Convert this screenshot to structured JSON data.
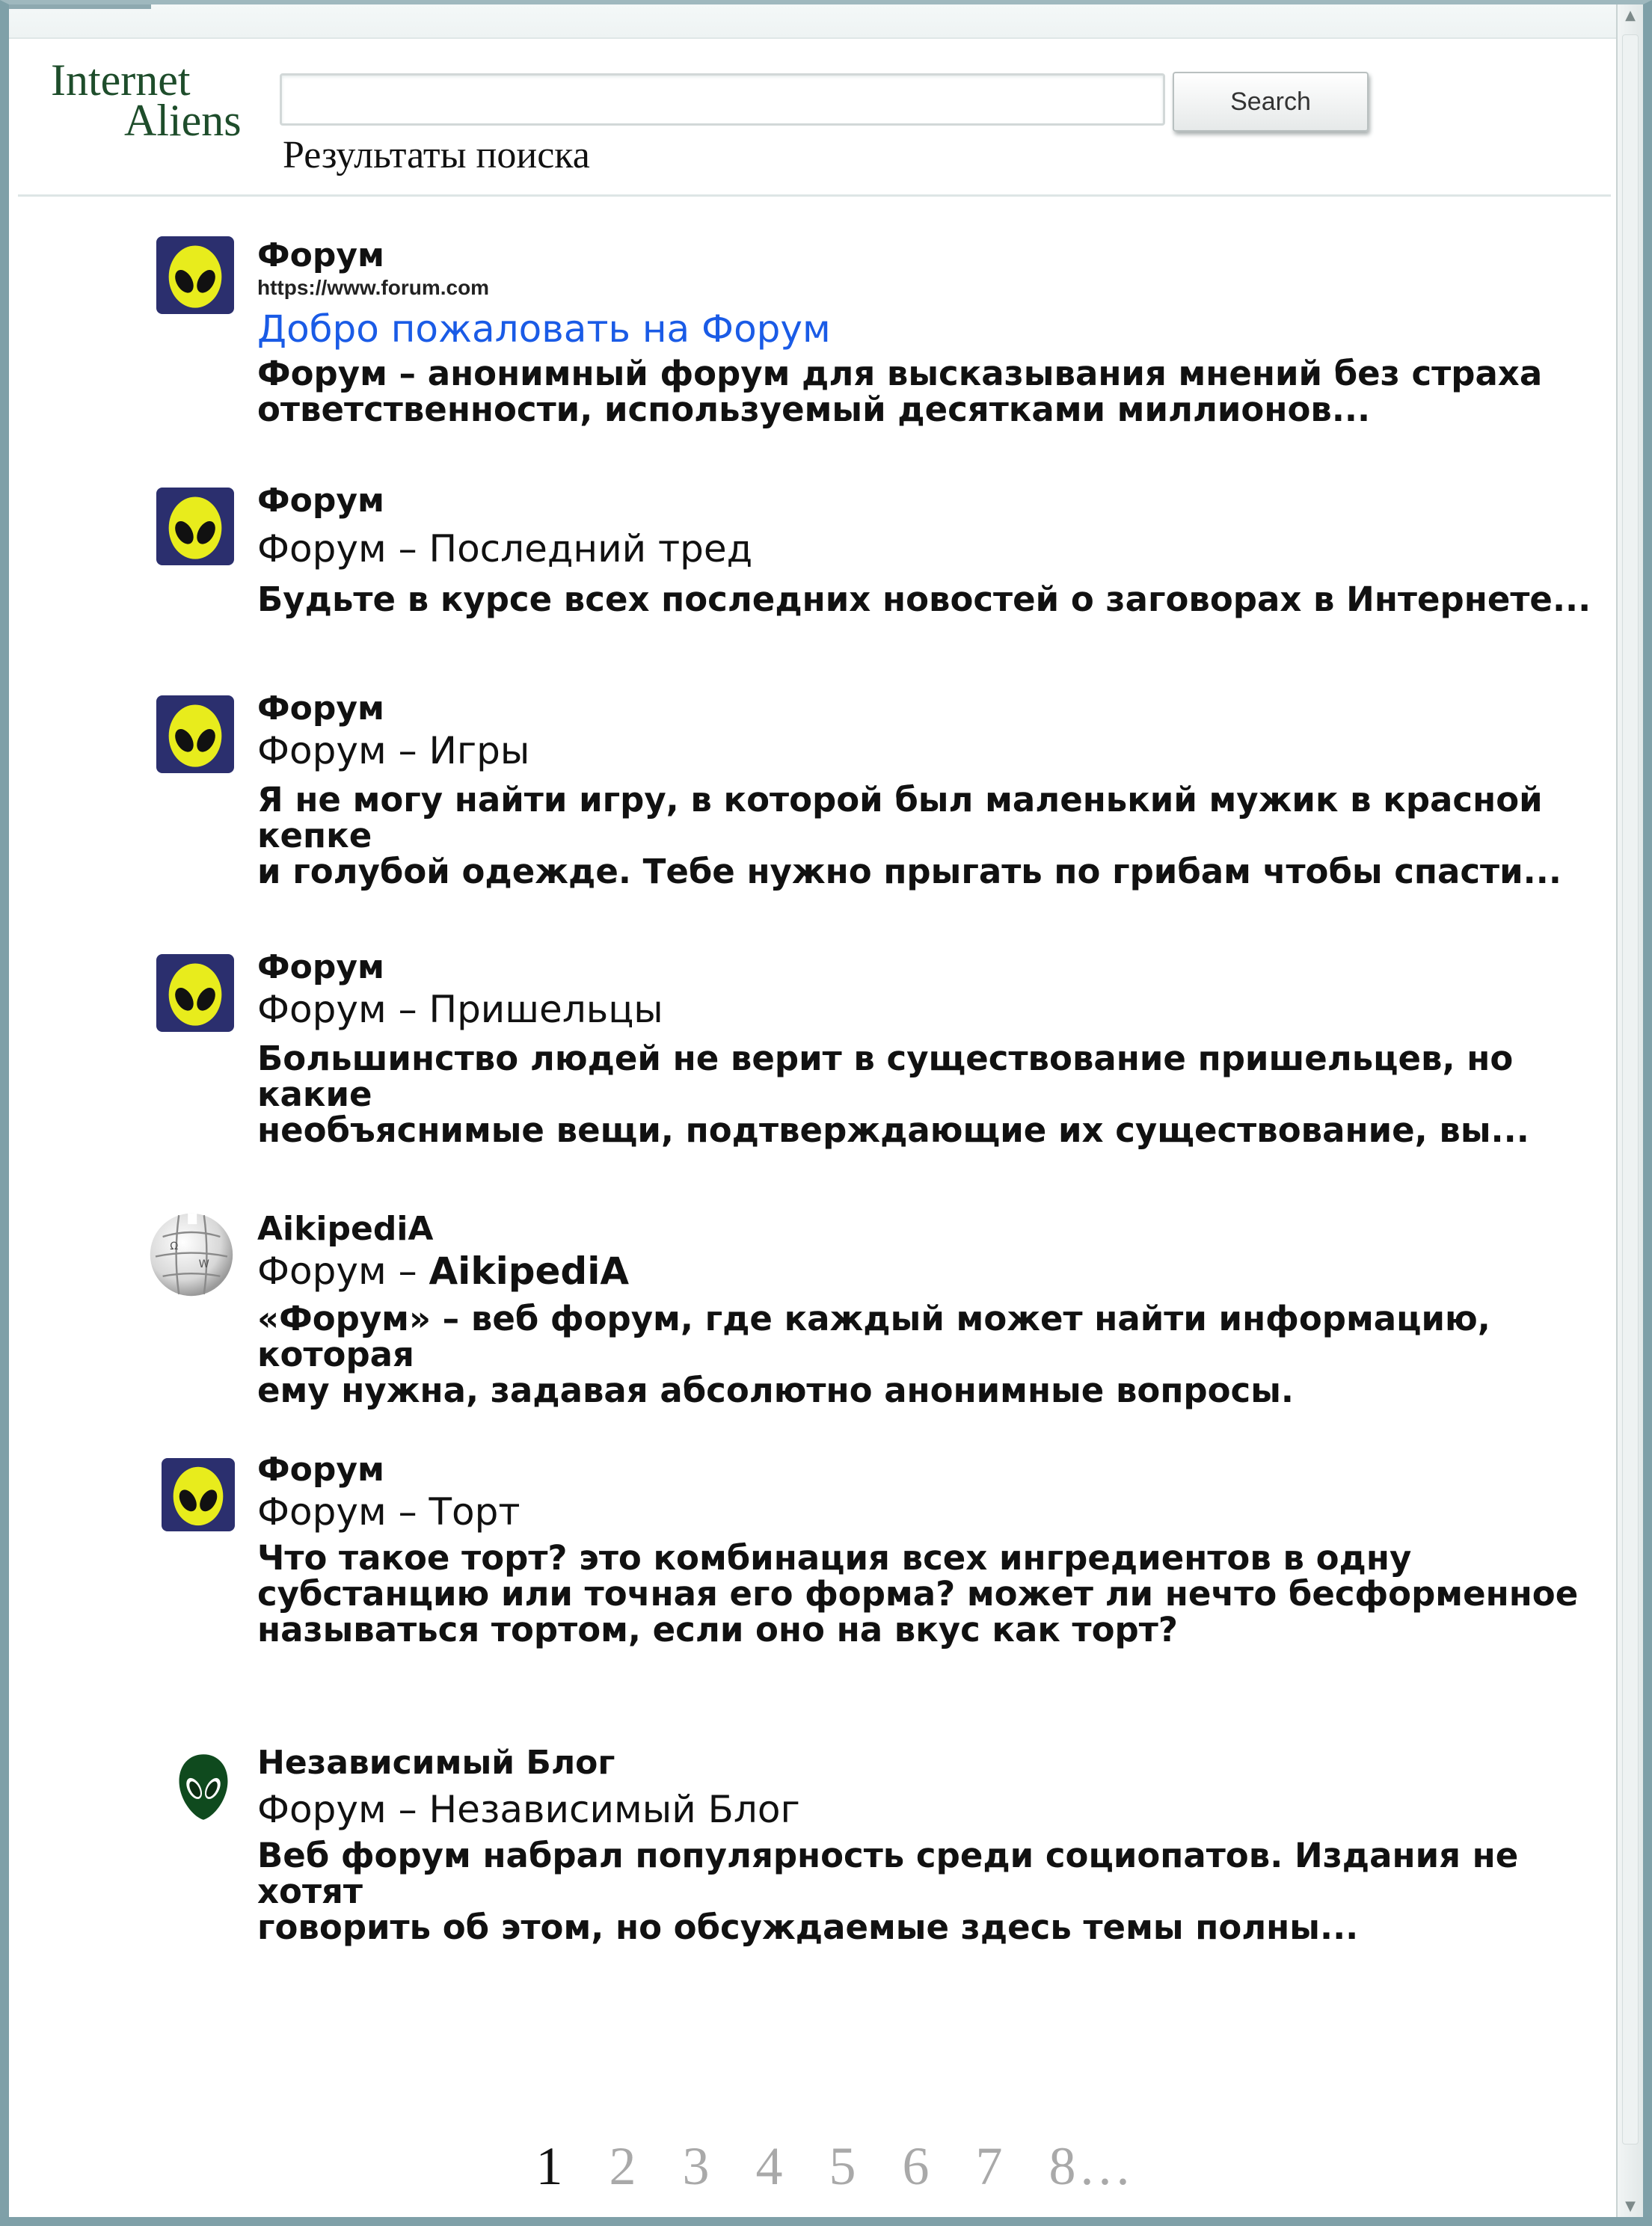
{
  "header": {
    "logo_line1": "Internet",
    "logo_line2": "Aliens",
    "search_value": "",
    "search_button": "Search",
    "results_heading": "Результаты поиска"
  },
  "colors": {
    "link_blue": "#1a5be6",
    "logo_green": "#1e4d2b",
    "favicon_bg": "#2b2f6e",
    "alien_yellow": "#e8ec1c"
  },
  "results": [
    {
      "icon": "alien-icon",
      "site": "Форум",
      "url": "https://www.forum.com",
      "title": "Добро пожаловать на Форум",
      "desc_line1": "Форум – анонимный форум для высказывания мнений без страха",
      "desc_line2": "ответственности, используемый десятками миллионов..."
    },
    {
      "icon": "alien-icon",
      "site": "Форум",
      "title": "Форум – Последний тред",
      "desc_line1": "Будьте в курсе всех последних новостей о заговорах в Интернете..."
    },
    {
      "icon": "alien-icon",
      "site": "Форум",
      "title": "Форум – Игры",
      "desc_line1": "Я не могу найти игру, в которой был маленький мужик в красной кепке",
      "desc_line2": "и голубой одежде. Тебе нужно прыгать по грибам чтобы спасти..."
    },
    {
      "icon": "alien-icon",
      "site": "Форум",
      "title": "Форум – Пришельцы",
      "desc_line1": "Большинство людей не верит в существование пришельцев, но какие",
      "desc_line2": "необъяснимые вещи, подтверждающие их существование, вы..."
    },
    {
      "icon": "globe-puzzle-icon",
      "site": "AikipediA",
      "title_prefix": "Форум –",
      "title_brand": "AikipediA",
      "desc_line1": "«Форум» – веб форум, где каждый может найти информацию, которая",
      "desc_line2": "ему нужна, задавая абсолютно анонимные вопросы."
    },
    {
      "icon": "alien-icon",
      "site": "Форум",
      "title": "Форум – Торт",
      "desc_line1": "Что такое торт? это комбинация всех ингредиентов в одну",
      "desc_line2": "субстанцию или точная его форма? может ли нечто бесформенное",
      "desc_line3": "называться тортом, если оно на вкус как торт?"
    },
    {
      "icon": "green-alien-icon",
      "site": "Независимый Блог",
      "title": "Форум – Независимый Блог",
      "desc_line1": "Веб форум набрал популярность среди социопатов. Издания не хотят",
      "desc_line2": "говорить об этом, но обсуждаемые здесь темы полны..."
    }
  ],
  "pagination": {
    "current": "1",
    "pages": [
      "2",
      "3",
      "4",
      "5",
      "6",
      "7"
    ],
    "last": "8..."
  }
}
